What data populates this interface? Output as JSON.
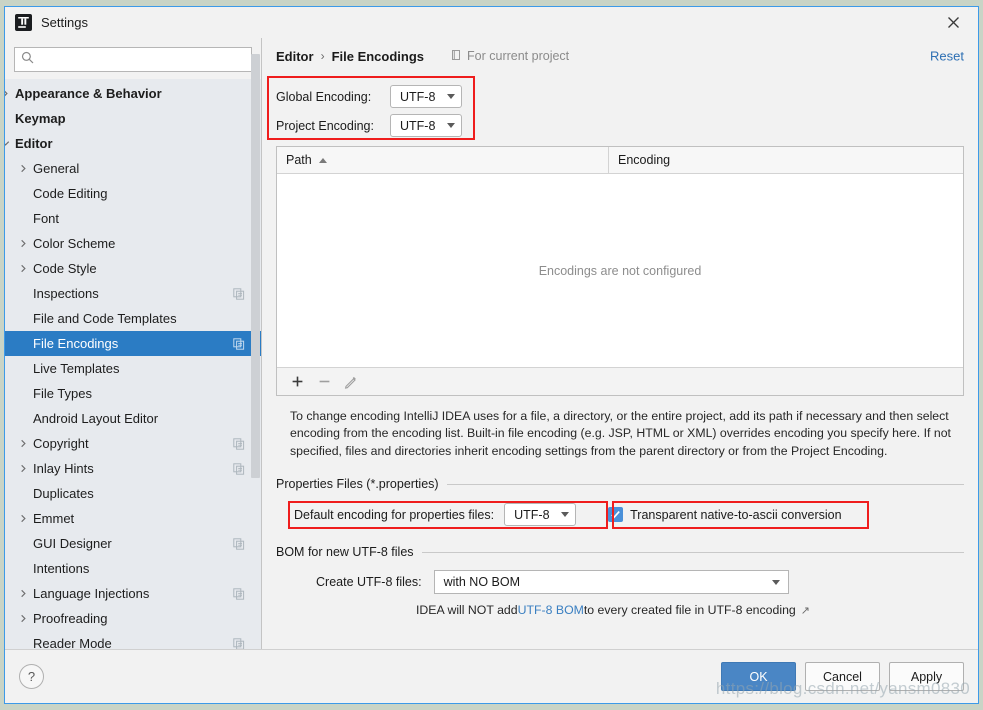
{
  "window": {
    "title": "Settings",
    "logo_icon": "intellij-idea-logo",
    "close_icon": "close-icon"
  },
  "sidebar": {
    "search": {
      "value": "",
      "placeholder": "",
      "icon": "search-icon"
    },
    "items": [
      {
        "label": "Appearance & Behavior",
        "level": 0,
        "bold": true,
        "arrow": "chevron-right",
        "proj": false,
        "selected": false
      },
      {
        "label": "Keymap",
        "level": 0,
        "bold": true,
        "arrow": "none",
        "proj": false,
        "selected": false
      },
      {
        "label": "Editor",
        "level": 0,
        "bold": true,
        "arrow": "chevron-down",
        "proj": false,
        "selected": false
      },
      {
        "label": "General",
        "level": 1,
        "bold": false,
        "arrow": "chevron-right",
        "proj": false,
        "selected": false
      },
      {
        "label": "Code Editing",
        "level": 1,
        "bold": false,
        "arrow": "none",
        "proj": false,
        "selected": false
      },
      {
        "label": "Font",
        "level": 1,
        "bold": false,
        "arrow": "none",
        "proj": false,
        "selected": false
      },
      {
        "label": "Color Scheme",
        "level": 1,
        "bold": false,
        "arrow": "chevron-right",
        "proj": false,
        "selected": false
      },
      {
        "label": "Code Style",
        "level": 1,
        "bold": false,
        "arrow": "chevron-right",
        "proj": false,
        "selected": false
      },
      {
        "label": "Inspections",
        "level": 1,
        "bold": false,
        "arrow": "none",
        "proj": true,
        "selected": false
      },
      {
        "label": "File and Code Templates",
        "level": 1,
        "bold": false,
        "arrow": "none",
        "proj": false,
        "selected": false
      },
      {
        "label": "File Encodings",
        "level": 1,
        "bold": false,
        "arrow": "none",
        "proj": true,
        "selected": true
      },
      {
        "label": "Live Templates",
        "level": 1,
        "bold": false,
        "arrow": "none",
        "proj": false,
        "selected": false
      },
      {
        "label": "File Types",
        "level": 1,
        "bold": false,
        "arrow": "none",
        "proj": false,
        "selected": false
      },
      {
        "label": "Android Layout Editor",
        "level": 1,
        "bold": false,
        "arrow": "none",
        "proj": false,
        "selected": false
      },
      {
        "label": "Copyright",
        "level": 1,
        "bold": false,
        "arrow": "chevron-right",
        "proj": true,
        "selected": false
      },
      {
        "label": "Inlay Hints",
        "level": 1,
        "bold": false,
        "arrow": "chevron-right",
        "proj": true,
        "selected": false
      },
      {
        "label": "Duplicates",
        "level": 1,
        "bold": false,
        "arrow": "none",
        "proj": false,
        "selected": false
      },
      {
        "label": "Emmet",
        "level": 1,
        "bold": false,
        "arrow": "chevron-right",
        "proj": false,
        "selected": false
      },
      {
        "label": "GUI Designer",
        "level": 1,
        "bold": false,
        "arrow": "none",
        "proj": true,
        "selected": false
      },
      {
        "label": "Intentions",
        "level": 1,
        "bold": false,
        "arrow": "none",
        "proj": false,
        "selected": false
      },
      {
        "label": "Language Injections",
        "level": 1,
        "bold": false,
        "arrow": "chevron-right",
        "proj": true,
        "selected": false
      },
      {
        "label": "Proofreading",
        "level": 1,
        "bold": false,
        "arrow": "chevron-right",
        "proj": false,
        "selected": false
      },
      {
        "label": "Reader Mode",
        "level": 1,
        "bold": false,
        "arrow": "none",
        "proj": true,
        "selected": false
      }
    ]
  },
  "main": {
    "breadcrumb": {
      "parent": "Editor",
      "separator": "›",
      "current": "File Encodings"
    },
    "for_current_project": {
      "label": "For current project",
      "icon": "project-scope-icon"
    },
    "reset_label": "Reset",
    "encodings": {
      "global": {
        "label": "Global Encoding:",
        "value": "UTF-8"
      },
      "project": {
        "label": "Project Encoding:",
        "value": "UTF-8"
      }
    },
    "table": {
      "columns": [
        "Path",
        "Encoding"
      ],
      "sorted_column": "Path",
      "sort_direction": "ascending",
      "rows": [],
      "empty_message": "Encodings are not configured",
      "toolbar": [
        {
          "name": "add",
          "glyph": "+",
          "enabled": true
        },
        {
          "name": "remove",
          "glyph": "−",
          "enabled": false
        },
        {
          "name": "edit",
          "glyph": "pencil",
          "enabled": false
        }
      ]
    },
    "description": "To change encoding IntelliJ IDEA uses for a file, a directory, or the entire project, add its path if necessary and then select encoding from the encoding list. Built-in file encoding (e.g. JSP, HTML or XML) overrides encoding you specify here. If not specified, files and directories inherit encoding settings from the parent directory or from the Project Encoding.",
    "properties_group": {
      "title": "Properties Files (*.properties)",
      "default_encoding_label": "Default encoding for properties files:",
      "default_encoding_value": "UTF-8",
      "transparent_label": "Transparent native-to-ascii conversion",
      "transparent_checked": true
    },
    "bom_group": {
      "title": "BOM for new UTF-8 files",
      "create_label": "Create UTF-8 files:",
      "create_value": "with NO BOM",
      "hint_before": "IDEA will NOT add ",
      "hint_link": "UTF-8 BOM",
      "hint_after": " to every created file in UTF-8 encoding",
      "external_icon": "external-link-icon"
    }
  },
  "footer": {
    "help_label": "?",
    "ok_label": "OK",
    "cancel_label": "Cancel",
    "apply_label": "Apply"
  },
  "watermark": "https://blog.csdn.net/yansm0830",
  "colors": {
    "accent_blue": "#2b7cc4",
    "primary_button": "#4a86c5",
    "highlight_red": "#ef1d1d",
    "link_blue": "#3a7fc1",
    "dialog_border": "#3d9ae8"
  }
}
